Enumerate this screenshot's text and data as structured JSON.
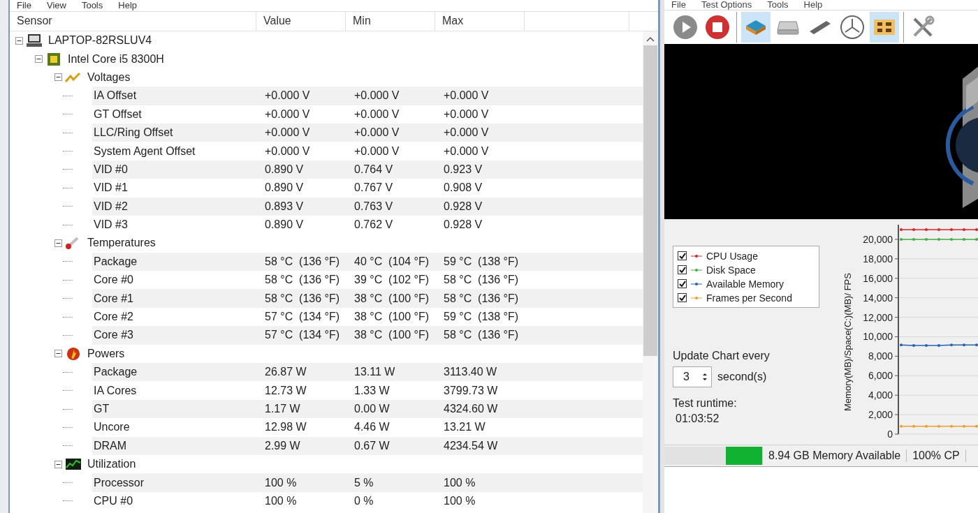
{
  "left_window": {
    "menu": [
      "File",
      "View",
      "Tools",
      "Help"
    ],
    "columns": [
      "Sensor",
      "Value",
      "Min",
      "Max"
    ],
    "tree": [
      {
        "label": "LAPTOP-82RSLUV4",
        "kind": "computer",
        "expanded": true,
        "children": [
          {
            "label": "Intel Core i5 8300H",
            "kind": "cpu",
            "expanded": true,
            "children": [
              {
                "label": "Voltages",
                "kind": "voltage",
                "expanded": true,
                "children": [
                  {
                    "label": "IA Offset",
                    "value": "+0.000 V",
                    "min": "+0.000 V",
                    "max": "+0.000 V"
                  },
                  {
                    "label": "GT Offset",
                    "value": "+0.000 V",
                    "min": "+0.000 V",
                    "max": "+0.000 V"
                  },
                  {
                    "label": "LLC/Ring Offset",
                    "value": "+0.000 V",
                    "min": "+0.000 V",
                    "max": "+0.000 V"
                  },
                  {
                    "label": "System Agent Offset",
                    "value": "+0.000 V",
                    "min": "+0.000 V",
                    "max": "+0.000 V"
                  },
                  {
                    "label": "VID #0",
                    "value": "0.890 V",
                    "min": "0.764 V",
                    "max": "0.923 V"
                  },
                  {
                    "label": "VID #1",
                    "value": "0.890 V",
                    "min": "0.767 V",
                    "max": "0.908 V"
                  },
                  {
                    "label": "VID #2",
                    "value": "0.893 V",
                    "min": "0.763 V",
                    "max": "0.928 V"
                  },
                  {
                    "label": "VID #3",
                    "value": "0.890 V",
                    "min": "0.762 V",
                    "max": "0.928 V"
                  }
                ]
              },
              {
                "label": "Temperatures",
                "kind": "temperature",
                "expanded": true,
                "children": [
                  {
                    "label": "Package",
                    "value": "58 °C  (136 °F)",
                    "min": "40 °C  (104 °F)",
                    "max": "59 °C  (138 °F)"
                  },
                  {
                    "label": "Core #0",
                    "value": "58 °C  (136 °F)",
                    "min": "39 °C  (102 °F)",
                    "max": "58 °C  (136 °F)"
                  },
                  {
                    "label": "Core #1",
                    "value": "58 °C  (136 °F)",
                    "min": "38 °C  (100 °F)",
                    "max": "58 °C  (136 °F)"
                  },
                  {
                    "label": "Core #2",
                    "value": "57 °C  (134 °F)",
                    "min": "38 °C  (100 °F)",
                    "max": "59 °C  (138 °F)"
                  },
                  {
                    "label": "Core #3",
                    "value": "57 °C  (134 °F)",
                    "min": "38 °C  (100 °F)",
                    "max": "58 °C  (136 °F)"
                  }
                ]
              },
              {
                "label": "Powers",
                "kind": "power",
                "expanded": true,
                "children": [
                  {
                    "label": "Package",
                    "value": "26.87 W",
                    "min": "13.11 W",
                    "max": "3113.40 W"
                  },
                  {
                    "label": "IA Cores",
                    "value": "12.73 W",
                    "min": "1.33 W",
                    "max": "3799.73 W"
                  },
                  {
                    "label": "GT",
                    "value": "1.17 W",
                    "min": "0.00 W",
                    "max": "4324.60 W"
                  },
                  {
                    "label": "Uncore",
                    "value": "12.98 W",
                    "min": "4.46 W",
                    "max": "13.21 W"
                  },
                  {
                    "label": "DRAM",
                    "value": "2.99 W",
                    "min": "0.67 W",
                    "max": "4234.54 W"
                  }
                ]
              },
              {
                "label": "Utilization",
                "kind": "utilization",
                "expanded": true,
                "children": [
                  {
                    "label": "Processor",
                    "value": "100 %",
                    "min": "5 %",
                    "max": "100 %"
                  },
                  {
                    "label": "CPU #0",
                    "value": "100 %",
                    "min": "0 %",
                    "max": "100 %"
                  }
                ]
              }
            ]
          }
        ]
      }
    ]
  },
  "right_window": {
    "menu": [
      "File",
      "Test Options",
      "Tools",
      "Help"
    ],
    "toolbar": [
      [
        {
          "kind": "play",
          "selected": false
        },
        {
          "kind": "stop",
          "selected": false
        }
      ],
      [
        {
          "kind": "chip",
          "selected": true
        },
        {
          "kind": "disk",
          "selected": false
        },
        {
          "kind": "memory-stick",
          "selected": false
        },
        {
          "kind": "dial",
          "selected": false
        },
        {
          "kind": "board",
          "selected": true
        }
      ],
      [
        {
          "kind": "tools",
          "selected": false
        }
      ]
    ],
    "legend": [
      {
        "checked": true
      },
      {
        "checked": true
      },
      {
        "checked": true
      },
      {
        "checked": true
      }
    ],
    "update_label": "Update Chart every",
    "interval": "3",
    "interval_unit": "second(s)",
    "runtime_label": "Test runtime:",
    "runtime": "01:03:52",
    "chart_data": {
      "type": "line",
      "grid": true,
      "ylabel": "Memory(MB)/Space(C:)(MB)/ FPS",
      "ylim": [
        0,
        21500
      ],
      "yticks": [
        {
          "value": 0,
          "label": "0"
        },
        {
          "value": 2000,
          "label": "2,000"
        },
        {
          "value": 4000,
          "label": "4,000"
        },
        {
          "value": 6000,
          "label": "6,000"
        },
        {
          "value": 8000,
          "label": "8,000"
        },
        {
          "value": 10000,
          "label": "10,000"
        },
        {
          "value": 12000,
          "label": "12,000"
        },
        {
          "value": 14000,
          "label": "14,000"
        },
        {
          "value": 16000,
          "label": "16,000"
        },
        {
          "value": 18000,
          "label": "18,000"
        },
        {
          "value": 20000,
          "label": "20,000"
        }
      ],
      "series": [
        {
          "name": "CPU Usage",
          "color": "#e02020",
          "values": [
            21000,
            21000,
            21000,
            21000,
            21000,
            21000,
            21000
          ]
        },
        {
          "name": "Disk Space",
          "color": "#40b040",
          "values": [
            20000,
            20000,
            20000,
            20000,
            20000,
            20000,
            20000
          ]
        },
        {
          "name": "Available Memory",
          "color": "#2060c0",
          "values": [
            9150,
            9100,
            9100,
            9100,
            9150,
            9150,
            9150
          ]
        },
        {
          "name": "Frames per Second",
          "color": "#f0a020",
          "values": [
            800,
            800,
            800,
            800,
            800,
            800,
            800
          ]
        }
      ]
    },
    "status": {
      "memory": "8.94 GB Memory Available",
      "cpu": "100% CP"
    }
  }
}
